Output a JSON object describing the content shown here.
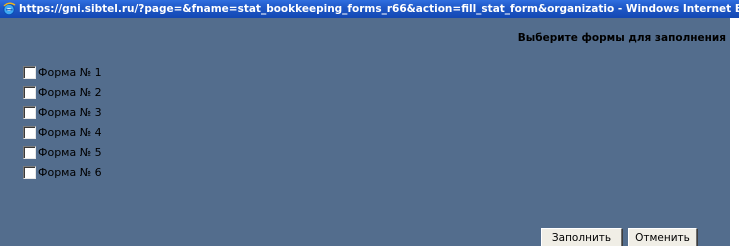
{
  "window": {
    "title": "https://gni.sibtel.ru/?page=&fname=stat_bookkeeping_forms_r66&action=fill_stat_form&organizatio - Windows Internet Explo"
  },
  "page": {
    "heading": "Выберите формы для заполнения",
    "forms": [
      {
        "label": "Форма № 1",
        "checked": false
      },
      {
        "label": "Форма № 2",
        "checked": false
      },
      {
        "label": "Форма № 3",
        "checked": false
      },
      {
        "label": "Форма № 4",
        "checked": false
      },
      {
        "label": "Форма № 5",
        "checked": false
      },
      {
        "label": "Форма № 6",
        "checked": false
      }
    ],
    "fill_button": "Заполнить",
    "cancel_button": "Отменить"
  },
  "colors": {
    "background": "#536d8d",
    "titlebar": "#1f59c8"
  },
  "icons": {
    "title_icon": "internet-explorer-icon"
  }
}
